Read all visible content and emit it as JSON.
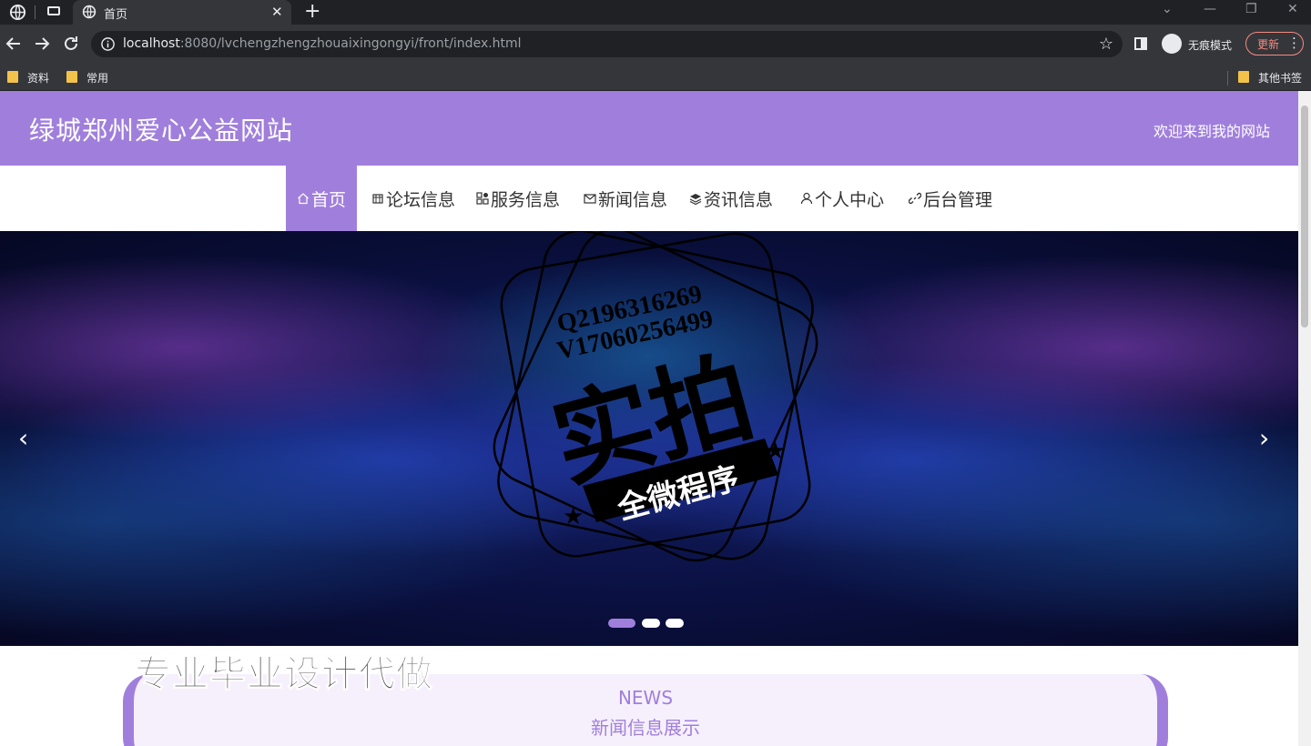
{
  "browser": {
    "tab_title": "首页",
    "url_host": "localhost",
    "url_rest": ":8080/lvchengzhengzhouaixingongyi/front/index.html",
    "incognito_label": "无痕模式",
    "update_label": "更新",
    "bookmarks": [
      "资料",
      "常用"
    ],
    "other_bookmarks": "其他书签"
  },
  "site": {
    "title": "绿城郑州爱心公益网站",
    "welcome": "欢迎来到我的网站"
  },
  "nav": [
    {
      "label": "首页",
      "icon": "home-icon",
      "active": true
    },
    {
      "label": "论坛信息",
      "icon": "forum-icon",
      "active": false
    },
    {
      "label": "服务信息",
      "icon": "grid-icon",
      "active": false
    },
    {
      "label": "新闻信息",
      "icon": "mail-icon",
      "active": false
    },
    {
      "label": "资讯信息",
      "icon": "layers-icon",
      "active": false
    },
    {
      "label": "个人中心",
      "icon": "user-icon",
      "active": false
    },
    {
      "label": "后台管理",
      "icon": "link-icon",
      "active": false
    }
  ],
  "banner": {
    "prev_arrow": "‹",
    "next_arrow": "›",
    "active_slide": 1,
    "slide_count": 3
  },
  "watermark": {
    "line1": "Q2196316269",
    "line2": "V17060256499",
    "big": "实拍",
    "ribbon": "全微程序"
  },
  "overlay_text": "专业毕业设计代做",
  "news_section": {
    "en": "NEWS",
    "cn": "新闻信息展示"
  },
  "colors": {
    "accent": "#a07fdc",
    "chrome_dark": "#202124",
    "chrome": "#35363a"
  }
}
